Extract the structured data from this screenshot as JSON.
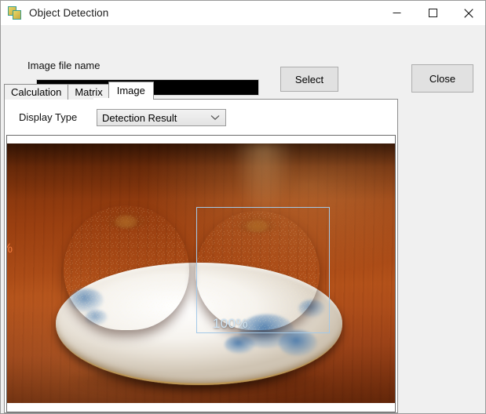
{
  "window": {
    "title": "Object Detection",
    "icon": "overlapping-squares-icon",
    "controls": {
      "minimize": "minimize-icon",
      "maximize": "maximize-icon",
      "close": "close-icon"
    }
  },
  "form": {
    "file_label": "Image file name",
    "file_value": "",
    "file_placeholder": "",
    "select_label": "Select",
    "close_label": "Close"
  },
  "tabs": {
    "items": [
      {
        "label": "Calculation",
        "selected": false
      },
      {
        "label": "Matrix",
        "selected": false
      },
      {
        "label": "Image",
        "selected": true
      }
    ]
  },
  "image_tab": {
    "display_type_label": "Display Type",
    "display_type_value": "Detection Result",
    "display_type_chevron": "chevron-down-icon"
  },
  "viewer": {
    "detections": [
      {
        "score_label": "100%",
        "box_color": "#a3c9e8",
        "text_color": "#cfe4f4"
      },
      {
        "score_label": "%",
        "box_color": "#f07a3c",
        "text_color": "#f07a3c"
      }
    ],
    "scene_description": "two asian pears on a white floral plate on a wooden table"
  },
  "colors": {
    "window_chrome": "#f0f0f0",
    "titlebar": "#ffffff",
    "button_face": "#e1e1e1",
    "button_border": "#adadad",
    "tab_border": "#8d8d8d",
    "panel": "#ffffff",
    "detection_accent": "#a3c9e8",
    "detection_accent_alt": "#f07a3c"
  }
}
